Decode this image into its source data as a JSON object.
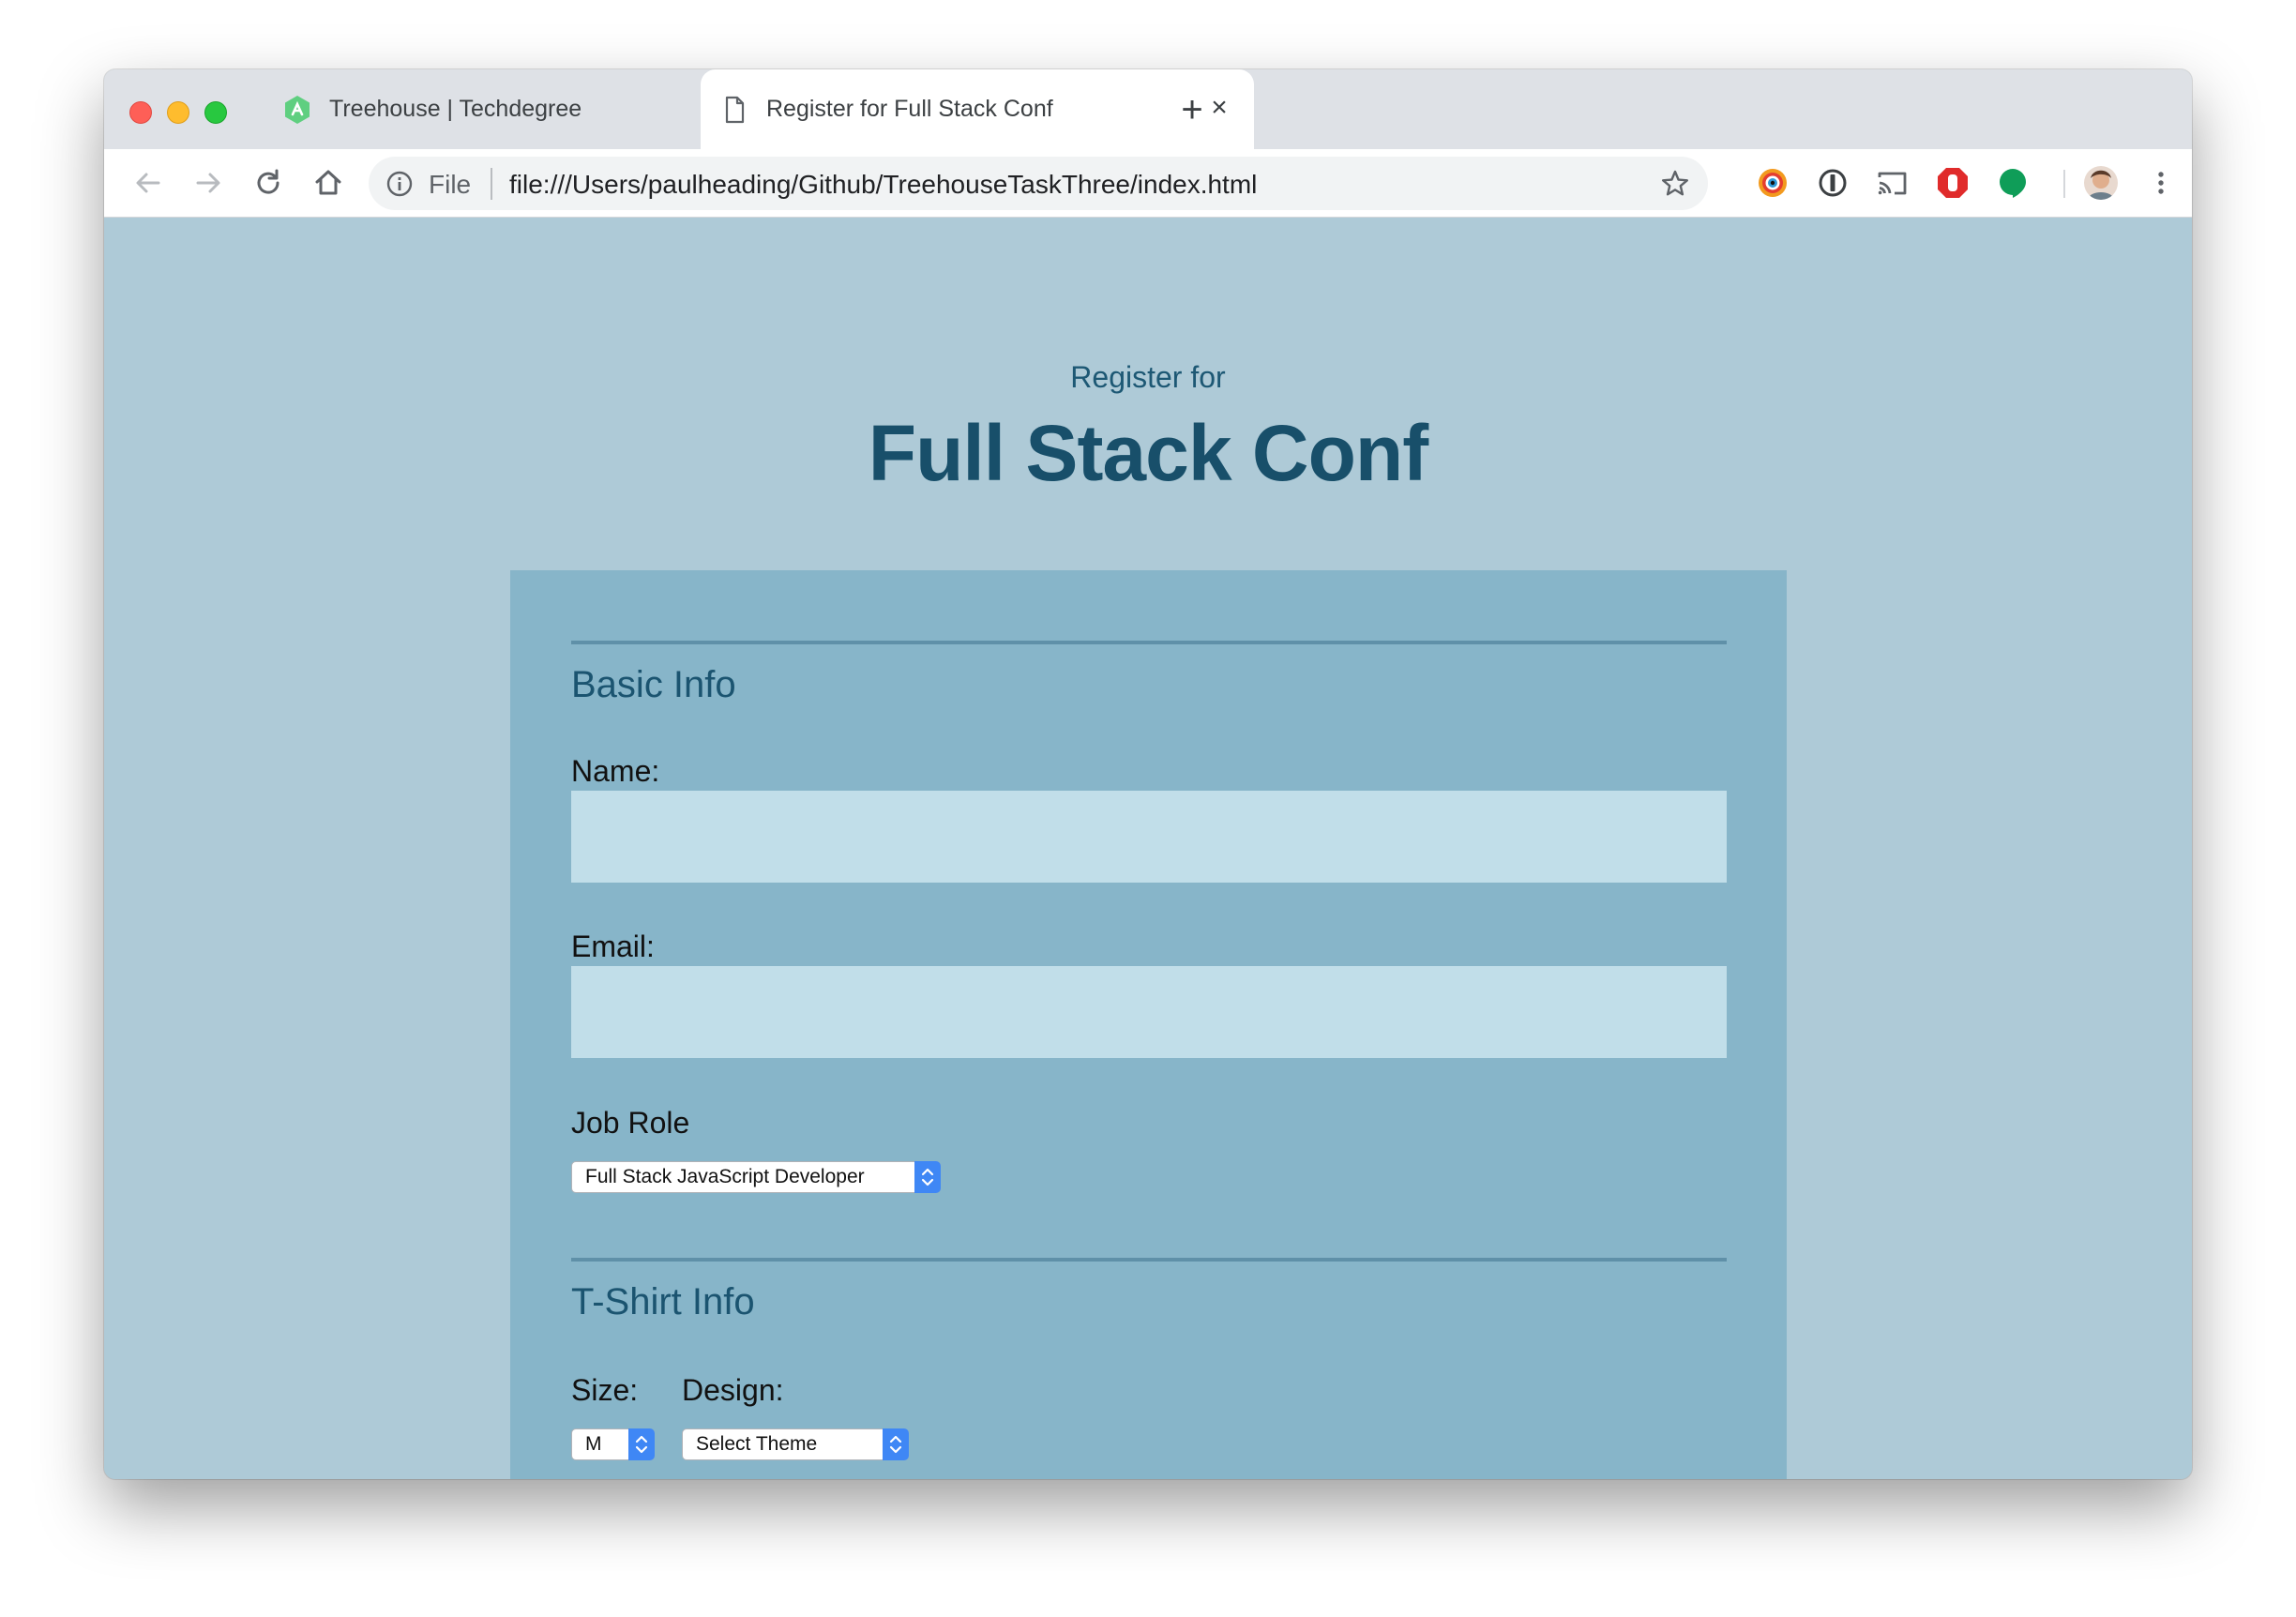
{
  "browser": {
    "tabs": [
      {
        "title": "Treehouse | Techdegree",
        "active": false,
        "icon": "treehouse-logo-icon"
      },
      {
        "title": "Register for Full Stack Conf",
        "active": true,
        "icon": "file-icon"
      }
    ],
    "close_glyph": "×",
    "new_tab_glyph": "+",
    "address": {
      "scheme_label": "File",
      "url": "file:///Users/paulheading/Github/TreehouseTaskThree/index.html"
    }
  },
  "page": {
    "header_sub": "Register for",
    "header_title": "Full Stack Conf",
    "basic_info": {
      "heading": "Basic Info",
      "name_label": "Name:",
      "name_value": "",
      "email_label": "Email:",
      "email_value": "",
      "job_role_label": "Job Role",
      "job_role_selected": "Full Stack JavaScript Developer"
    },
    "tshirt_info": {
      "heading": "T-Shirt Info",
      "size_label": "Size:",
      "size_selected": "M",
      "design_label": "Design:",
      "design_selected": "Select Theme"
    }
  },
  "colors": {
    "page_bg": "#aecad7",
    "form_bg": "#87b5c9",
    "input_bg": "#c1dee9",
    "heading": "#184f6a",
    "select_arrow": "#3f87f5"
  }
}
